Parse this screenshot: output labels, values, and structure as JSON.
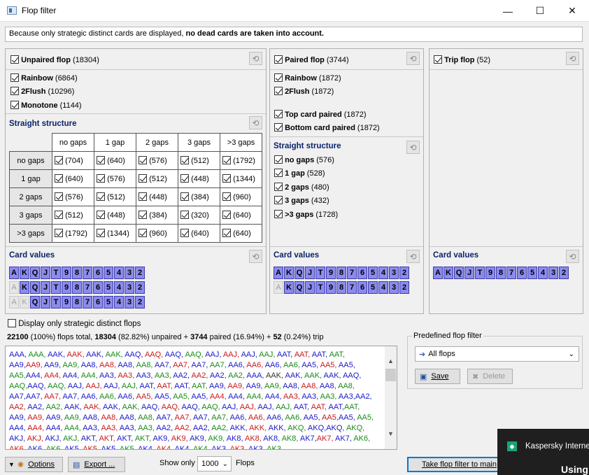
{
  "window": {
    "title": "Flop filter",
    "minimize": "—",
    "maximize": "☐",
    "close": "✕"
  },
  "info": {
    "prefix": "Because only strategic distinct cards are displayed, ",
    "bold": "no dead cards are taken into account."
  },
  "unpaired": {
    "label": "Unpaired flop",
    "count": "(18304)",
    "suits": [
      {
        "label": "Rainbow",
        "count": "(6864)"
      },
      {
        "label": "2Flush",
        "count": "(10296)"
      },
      {
        "label": "Monotone",
        "count": "(1144)"
      }
    ],
    "structure_title": "Straight structure",
    "col_headers": [
      "no gaps",
      "1 gap",
      "2 gaps",
      "3 gaps",
      ">3 gaps"
    ],
    "row_headers": [
      "no gaps",
      "1 gap",
      "2 gaps",
      "3 gaps",
      ">3 gaps"
    ],
    "cells": [
      [
        "(704)",
        "(640)",
        "(576)",
        "(512)",
        "(1792)"
      ],
      [
        "(640)",
        "(576)",
        "(512)",
        "(448)",
        "(1344)"
      ],
      [
        "(576)",
        "(512)",
        "(448)",
        "(384)",
        "(960)"
      ],
      [
        "(512)",
        "(448)",
        "(384)",
        "(320)",
        "(640)"
      ],
      [
        "(1792)",
        "(1344)",
        "(960)",
        "(640)",
        "(640)"
      ]
    ],
    "card_values_title": "Card values"
  },
  "paired": {
    "label": "Paired flop",
    "count": "(3744)",
    "suits": [
      {
        "label": "Rainbow",
        "count": "(1872)"
      },
      {
        "label": "2Flush",
        "count": "(1872)"
      }
    ],
    "kinds": [
      {
        "label": "Top card paired",
        "count": "(1872)"
      },
      {
        "label": "Bottom card paired",
        "count": "(1872)"
      }
    ],
    "structure_title": "Straight structure",
    "gaps": [
      {
        "label": "no gaps",
        "count": "(576)"
      },
      {
        "label": "1 gap",
        "count": "(528)"
      },
      {
        "label": "2 gaps",
        "count": "(480)"
      },
      {
        "label": "3 gaps",
        "count": "(432)"
      },
      {
        "label": ">3 gaps",
        "count": "(1728)"
      }
    ],
    "card_values_title": "Card values"
  },
  "trip": {
    "label": "Trip flop",
    "count": "(52)",
    "card_values_title": "Card values"
  },
  "ranks": [
    "A",
    "K",
    "Q",
    "J",
    "T",
    "9",
    "8",
    "7",
    "6",
    "5",
    "4",
    "3",
    "2"
  ],
  "display_strategic": "Display only strategic distinct flops",
  "summary": {
    "total": "22100",
    "total_rest": " (100%) flops total, ",
    "unpaired": "18304",
    "unpaired_rest": " (82.82%) unpaired + ",
    "paired": "3744",
    "paired_rest": " paired (16.94%) + ",
    "trip": "52",
    "trip_rest": " (0.24%) trip"
  },
  "flops_text": [
    [
      "AAA, ",
      "b"
    ],
    [
      "AAA, ",
      "g"
    ],
    [
      "AAK, ",
      "b"
    ],
    [
      "AAK, ",
      "r"
    ],
    [
      "AAK, ",
      "b"
    ],
    [
      "AAK, ",
      "g"
    ],
    [
      "AAQ, ",
      "b"
    ],
    [
      "AAQ, ",
      "r"
    ],
    [
      "AAQ, ",
      "b"
    ],
    [
      "AAQ, ",
      "g"
    ],
    [
      "AAJ, ",
      "b"
    ],
    [
      "AAJ, ",
      "r"
    ],
    [
      "AAJ, ",
      "b"
    ],
    [
      "AAJ, ",
      "g"
    ],
    [
      "AAT, ",
      "b"
    ],
    [
      "AAT, ",
      "r"
    ],
    [
      "AAT, ",
      "b"
    ],
    [
      "AAT, ",
      "g"
    ],
    [
      "AA9,",
      "b"
    ],
    [
      "AA9, ",
      "r"
    ],
    [
      "AA9, ",
      "b"
    ],
    [
      "AA9, ",
      "g"
    ],
    [
      "AA8, ",
      "b"
    ],
    [
      "AA8, ",
      "r"
    ],
    [
      "AA8, ",
      "b"
    ],
    [
      "AA8, ",
      "g"
    ],
    [
      "AA7, ",
      "b"
    ],
    [
      "AA7, ",
      "r"
    ],
    [
      "AA7, ",
      "b"
    ],
    [
      "AA7, ",
      "g"
    ],
    [
      "AA6, ",
      "b"
    ],
    [
      "AA6, ",
      "r"
    ],
    [
      "AA6, ",
      "b"
    ],
    [
      "AA6, ",
      "g"
    ],
    [
      "AA5, ",
      "b"
    ],
    [
      "AA5, ",
      "r"
    ],
    [
      "AA5, ",
      "b"
    ],
    [
      "AA5,",
      "g"
    ],
    [
      "AA4, ",
      "b"
    ],
    [
      "AA4, ",
      "r"
    ],
    [
      "AA4, ",
      "b"
    ],
    [
      "AA4, ",
      "g"
    ],
    [
      "AA3, ",
      "b"
    ],
    [
      "AA3, ",
      "r"
    ],
    [
      "AA3, ",
      "b"
    ],
    [
      "AA3, ",
      "g"
    ],
    [
      "AA2, ",
      "b"
    ],
    [
      "AA2, ",
      "r"
    ],
    [
      "AA2, ",
      "b"
    ],
    [
      "AA2, ",
      "g"
    ],
    [
      "AAA, ",
      "b"
    ],
    [
      "AAK, ",
      "k"
    ],
    [
      "AAK, ",
      "b"
    ],
    [
      "AAK, ",
      "g"
    ],
    [
      "AAK, ",
      "b"
    ],
    [
      "AAQ, ",
      "b"
    ],
    [
      "AAQ,",
      "g"
    ],
    [
      "AAQ, ",
      "b"
    ],
    [
      "AAQ, ",
      "g"
    ],
    [
      "AAJ, ",
      "b"
    ],
    [
      "AAJ, ",
      "r"
    ],
    [
      "AAJ, ",
      "b"
    ],
    [
      "AAJ, ",
      "g"
    ],
    [
      "AAT, ",
      "b"
    ],
    [
      "AAT, ",
      "r"
    ],
    [
      "AAT, ",
      "b"
    ],
    [
      "AAT, ",
      "g"
    ],
    [
      "AA9, ",
      "b"
    ],
    [
      "AA9, ",
      "r"
    ],
    [
      "AA9, ",
      "b"
    ],
    [
      "AA9, ",
      "g"
    ],
    [
      "AA8, ",
      "b"
    ],
    [
      "AA8, ",
      "r"
    ],
    [
      "AA8, ",
      "b"
    ],
    [
      "AA8, ",
      "g"
    ],
    [
      "AA7,",
      "b"
    ],
    [
      "AA7, ",
      "b"
    ],
    [
      "AA7, ",
      "r"
    ],
    [
      "AA7, ",
      "b"
    ],
    [
      "AA6, ",
      "b"
    ],
    [
      "AA6, ",
      "g"
    ],
    [
      "AA6, ",
      "b"
    ],
    [
      "AA5, ",
      "r"
    ],
    [
      "AA5, ",
      "b"
    ],
    [
      "AA5, ",
      "g"
    ],
    [
      "AA5, ",
      "b"
    ],
    [
      "AA4, ",
      "r"
    ],
    [
      "AA4, ",
      "b"
    ],
    [
      "AA4, ",
      "g"
    ],
    [
      "AA4, ",
      "b"
    ],
    [
      "AA3, ",
      "r"
    ],
    [
      "AA3, ",
      "b"
    ],
    [
      "AA3, ",
      "g"
    ],
    [
      "AA3,",
      "b"
    ],
    [
      "AA2, ",
      "b"
    ],
    [
      "AA2, ",
      "r"
    ],
    [
      "AA2, ",
      "b"
    ],
    [
      "AA2, ",
      "g"
    ],
    [
      "AAK, ",
      "b"
    ],
    [
      "AAK, ",
      "r"
    ],
    [
      "AAK, ",
      "b"
    ],
    [
      "AAK, ",
      "g"
    ],
    [
      "AAQ, ",
      "b"
    ],
    [
      "AAQ, ",
      "r"
    ],
    [
      "AAQ, ",
      "b"
    ],
    [
      "AAQ, ",
      "g"
    ],
    [
      "AAJ, ",
      "b"
    ],
    [
      "AAJ, ",
      "r"
    ],
    [
      "AAJ, ",
      "b"
    ],
    [
      "AAJ, ",
      "g"
    ],
    [
      "AAT, ",
      "b"
    ],
    [
      "AAT, ",
      "r"
    ],
    [
      "AAT,",
      "b"
    ],
    [
      "AAT, ",
      "g"
    ],
    [
      "AA9, ",
      "b"
    ],
    [
      "AA9, ",
      "r"
    ],
    [
      "AA9, ",
      "b"
    ],
    [
      "AA9, ",
      "g"
    ],
    [
      "AA8, ",
      "b"
    ],
    [
      "AA8, ",
      "r"
    ],
    [
      "AA8, ",
      "b"
    ],
    [
      "AA8, ",
      "g"
    ],
    [
      "AA7, ",
      "b"
    ],
    [
      "AA7, ",
      "r"
    ],
    [
      "AA7, ",
      "b"
    ],
    [
      "AA7, ",
      "g"
    ],
    [
      "AA6, ",
      "b"
    ],
    [
      "AA6, ",
      "r"
    ],
    [
      "AA6, ",
      "b"
    ],
    [
      "AA6, ",
      "g"
    ],
    [
      "AA5, ",
      "b"
    ],
    [
      "AA5,",
      "r"
    ],
    [
      "AA5, ",
      "b"
    ],
    [
      "AA5, ",
      "g"
    ],
    [
      "AA4, ",
      "b"
    ],
    [
      "AA4, ",
      "r"
    ],
    [
      "AA4, ",
      "b"
    ],
    [
      "AA4, ",
      "g"
    ],
    [
      "AA3, ",
      "b"
    ],
    [
      "AA3, ",
      "r"
    ],
    [
      "AA3, ",
      "b"
    ],
    [
      "AA3, ",
      "g"
    ],
    [
      "AA2, ",
      "b"
    ],
    [
      "AA2, ",
      "r"
    ],
    [
      "AA2, ",
      "b"
    ],
    [
      "AA2, ",
      "g"
    ],
    [
      "AKK, ",
      "b"
    ],
    [
      "AKK, ",
      "r"
    ],
    [
      "AKK, ",
      "b"
    ],
    [
      "AKQ, ",
      "g"
    ],
    [
      "AKQ,",
      "b"
    ],
    [
      "AKQ, ",
      "b"
    ],
    [
      "AKQ, ",
      "g"
    ],
    [
      "AKJ, ",
      "b"
    ],
    [
      "AKJ, ",
      "r"
    ],
    [
      "AKJ, ",
      "b"
    ],
    [
      "AKJ, ",
      "g"
    ],
    [
      "AKT, ",
      "b"
    ],
    [
      "AKT, ",
      "r"
    ],
    [
      "AKT, ",
      "b"
    ],
    [
      "AKT, ",
      "g"
    ],
    [
      "AK9, ",
      "b"
    ],
    [
      "AK9, ",
      "r"
    ],
    [
      "AK9, ",
      "b"
    ],
    [
      "AK9, ",
      "g"
    ],
    [
      "AK8, ",
      "b"
    ],
    [
      "AK8, ",
      "r"
    ],
    [
      "AK8, ",
      "b"
    ],
    [
      "AK8, ",
      "g"
    ],
    [
      "AK7,",
      "b"
    ],
    [
      "AK7, ",
      "r"
    ],
    [
      "AK7, ",
      "b"
    ],
    [
      "AK6, ",
      "g"
    ],
    [
      "AK6, ",
      "r"
    ],
    [
      "AK6, ",
      "b"
    ],
    [
      "AK6, ",
      "g"
    ],
    [
      "AK5, ",
      "b"
    ],
    [
      "AK5, ",
      "r"
    ],
    [
      "AK5, ",
      "b"
    ],
    [
      "AK5, ",
      "g"
    ],
    [
      "AK4, ",
      "b"
    ],
    [
      "AK4, ",
      "r"
    ],
    [
      "AK4, ",
      "b"
    ],
    [
      "AK4, ",
      "g"
    ],
    [
      "AK3, ",
      "b"
    ],
    [
      "AK3, ",
      "r"
    ],
    [
      "AK3, ",
      "b"
    ],
    [
      "AK3,",
      "g"
    ]
  ],
  "predefined": {
    "title": "Predefined flop filter",
    "selected": "All flops",
    "save": "Save",
    "delete": "Delete"
  },
  "bottom": {
    "options": "Options",
    "export": "Export ...",
    "show_only": "Show only",
    "show_value": "1000",
    "flops": "Flops",
    "take": "Take flop filter to main"
  },
  "kaspersky": {
    "title": "Kaspersky Interne",
    "sub": "Using"
  }
}
